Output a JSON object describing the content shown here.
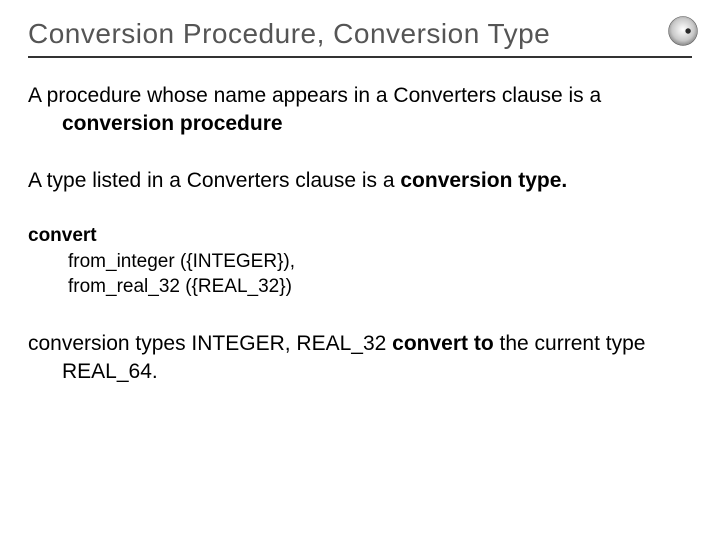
{
  "title": "Conversion Procedure, Conversion Type",
  "para1": {
    "pre": "A procedure whose name appears in a Converters clause is a ",
    "bold": "conversion procedure"
  },
  "para2": {
    "pre": "A type listed in a Converters clause is a ",
    "bold": "conversion type."
  },
  "code": {
    "keyword": "convert",
    "line1": "from_integer ({INTEGER}),",
    "line2": "from_real_32 ({REAL_32})"
  },
  "para3": {
    "pre": "conversion types INTEGER, REAL_32 ",
    "bold": "convert to",
    "post": " the current type REAL_64."
  }
}
